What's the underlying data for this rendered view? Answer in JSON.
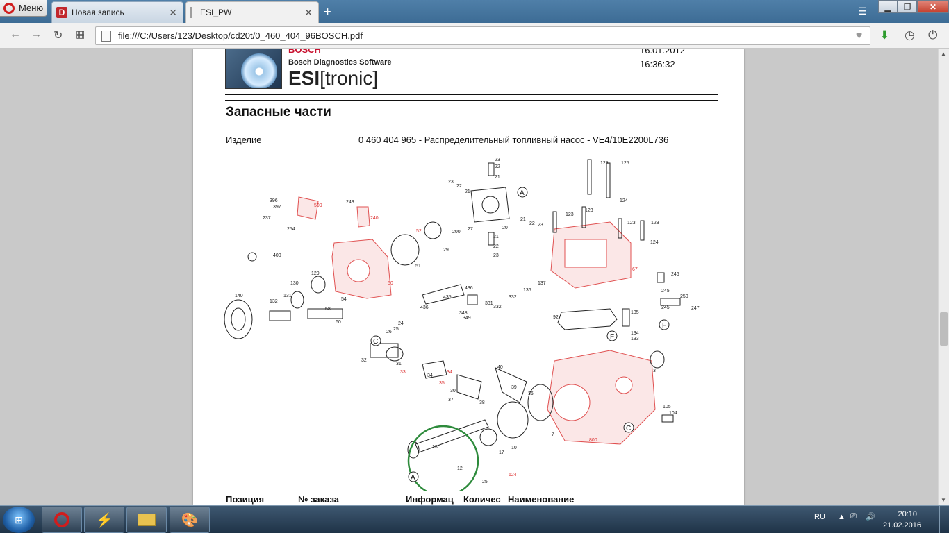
{
  "browser": {
    "menu_label": "Меню",
    "tabs": [
      {
        "title": "Новая запись"
      },
      {
        "title": "ESI_PW"
      }
    ],
    "address": "file:///C:/Users/123/Desktop/cd20t/0_460_404_96BOSCH.pdf"
  },
  "document": {
    "brand": "BOSCH",
    "subtitle": "Bosch Diagnostics Software",
    "product_prefix": "ESI",
    "product_suffix": "[tronic]",
    "date": "16.01.2012",
    "time": "16:36:32",
    "section_title": "Запасные части",
    "product_label": "Изделие",
    "product_value": "0 460 404 965 - Распределительный топливный насос - VE4/10E2200L736",
    "columns": [
      "Позиция",
      "№ заказа",
      "Информац",
      "Количес",
      "Наименование"
    ],
    "diagram_labels": {
      "black": [
        "23",
        "22",
        "21",
        "23",
        "22",
        "21",
        "20",
        "21",
        "22",
        "23",
        "27",
        "200",
        "29",
        "21",
        "22",
        "23",
        "125",
        "125",
        "123",
        "123",
        "123",
        "123",
        "124",
        "124",
        "396",
        "397",
        "237",
        "254",
        "243",
        "400",
        "129",
        "130",
        "131",
        "132",
        "140",
        "58",
        "54",
        "60",
        "51",
        "435",
        "436",
        "436",
        "332",
        "331",
        "137",
        "136",
        "332",
        "349",
        "348",
        "246",
        "245",
        "250",
        "245",
        "247",
        "135",
        "134",
        "133",
        "92",
        "26",
        "25",
        "24",
        "32",
        "31",
        "34",
        "30",
        "37",
        "38",
        "40",
        "39",
        "36",
        "7",
        "3",
        "105",
        "104",
        "13",
        "12",
        "10",
        "17",
        "25"
      ],
      "red": [
        "509",
        "240",
        "50",
        "52",
        "67",
        "33",
        "34",
        "35",
        "800",
        "624"
      ],
      "letters": [
        "A",
        "C",
        "F",
        "F",
        "C",
        "A"
      ]
    }
  },
  "taskbar": {
    "lang": "RU",
    "clock_time": "20:10",
    "clock_date": "21.02.2016"
  }
}
